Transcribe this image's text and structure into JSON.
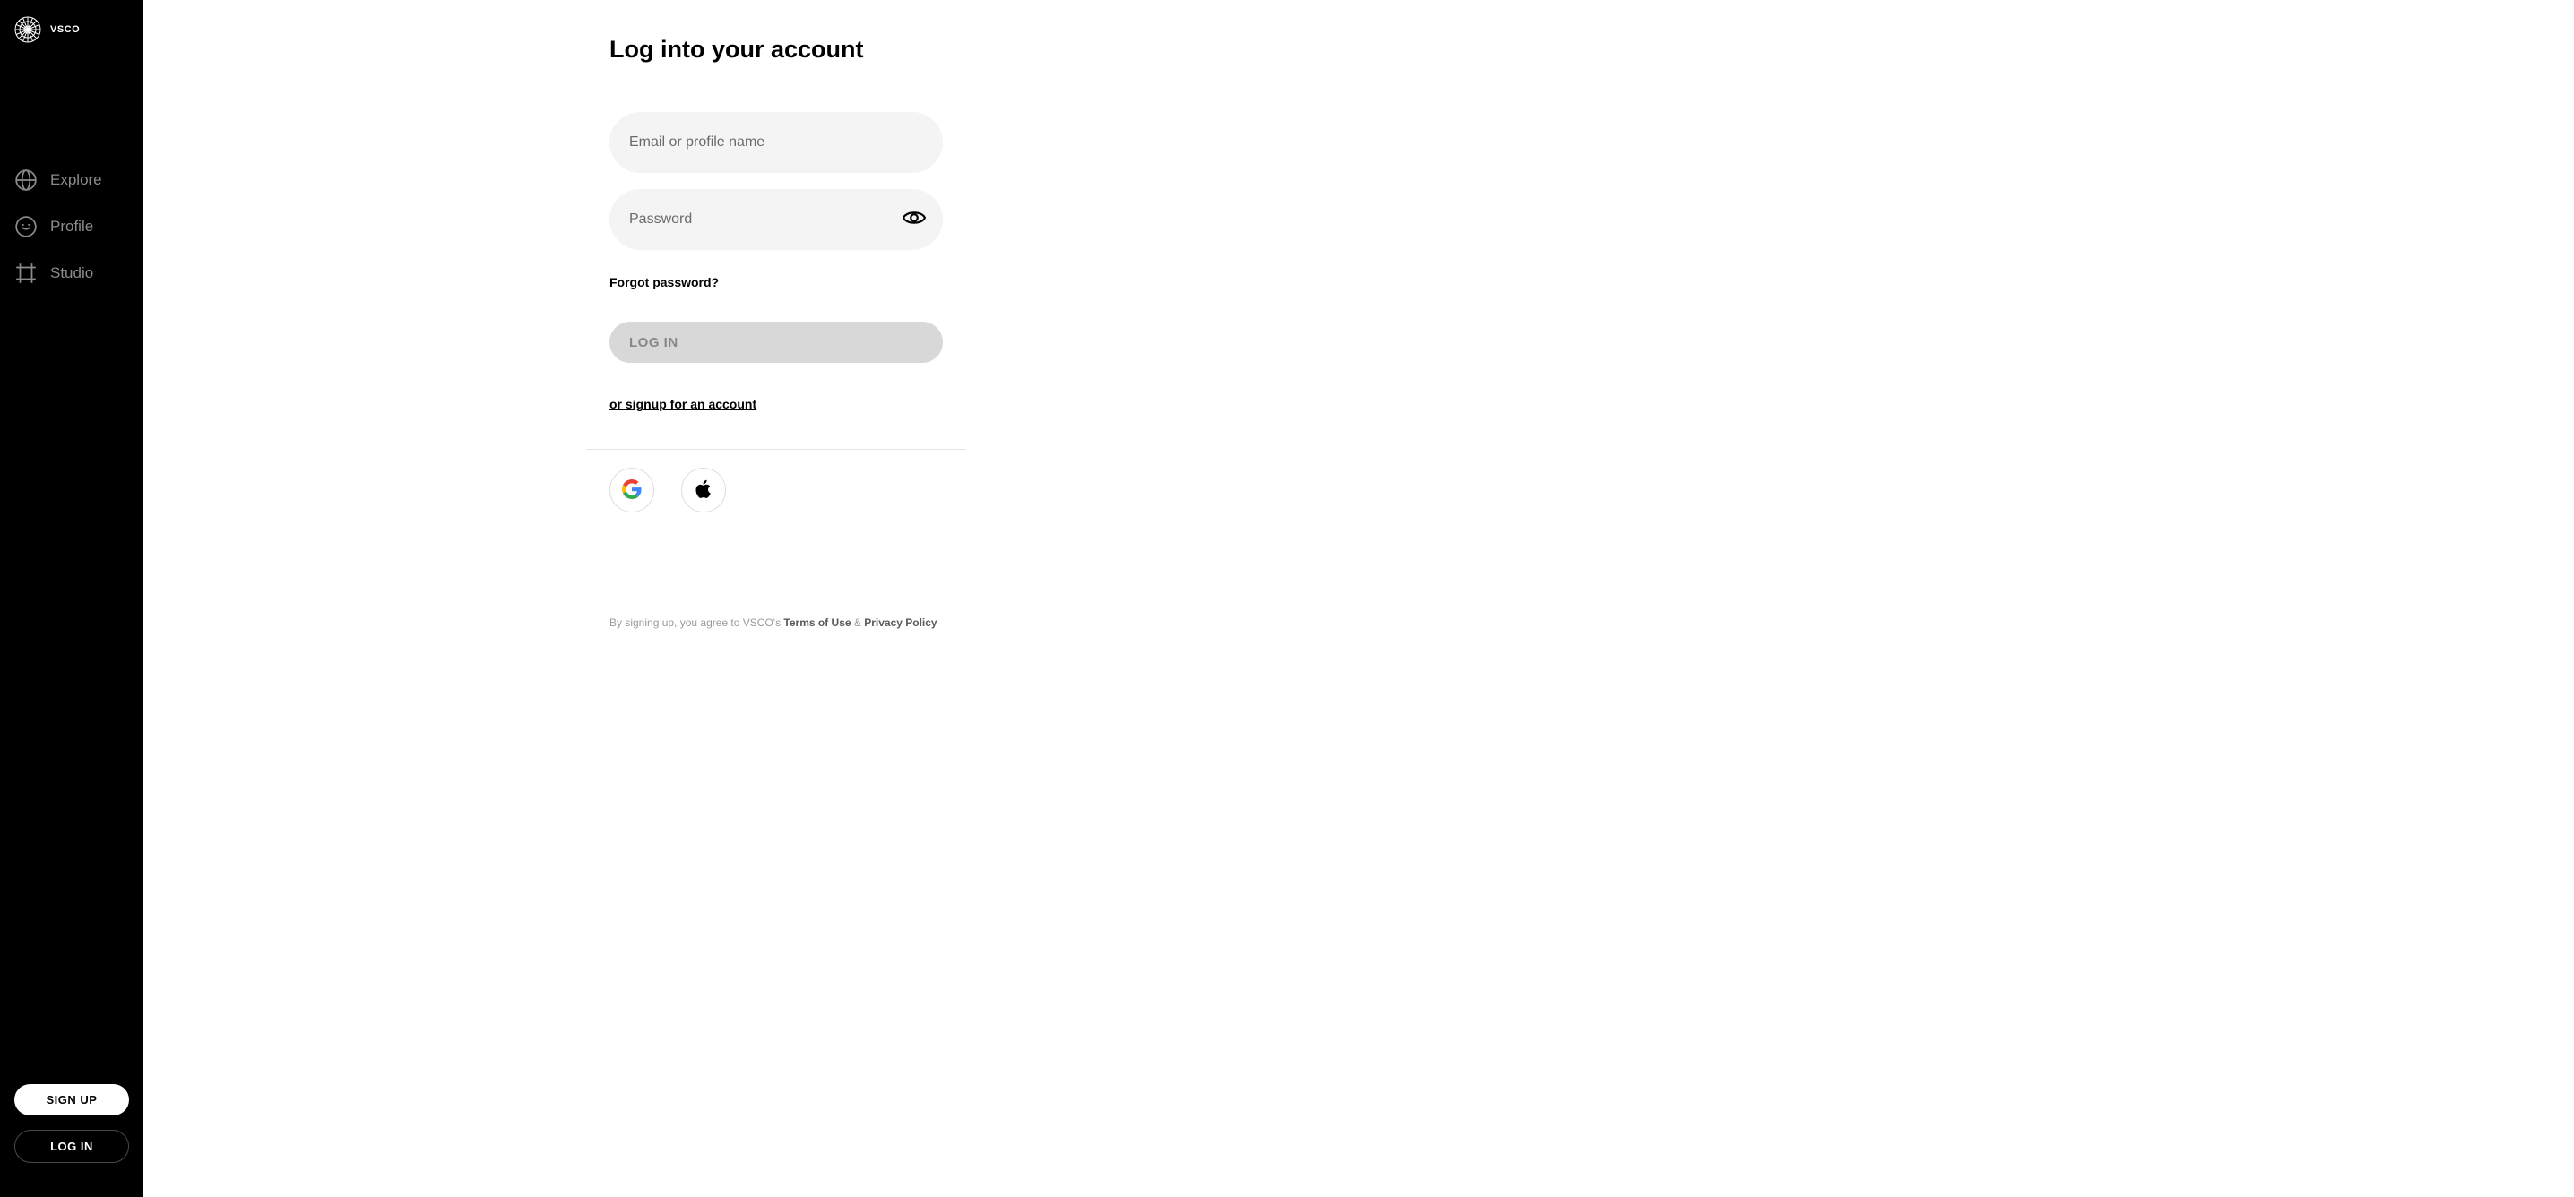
{
  "brand": "VSCO",
  "sidebar": {
    "nav": [
      {
        "label": "Explore"
      },
      {
        "label": "Profile"
      },
      {
        "label": "Studio"
      }
    ],
    "signup_label": "SIGN UP",
    "login_label": "LOG IN"
  },
  "page": {
    "title": "Log into your account",
    "email_placeholder": "Email or profile name",
    "password_placeholder": "Password",
    "forgot_label": "Forgot password?",
    "login_button": "LOG IN",
    "signup_link": "or signup for an account",
    "footer_prefix": "By signing up, you agree to VSCO's ",
    "footer_terms": "Terms of Use",
    "footer_amp": " & ",
    "footer_privacy": "Privacy Policy"
  }
}
